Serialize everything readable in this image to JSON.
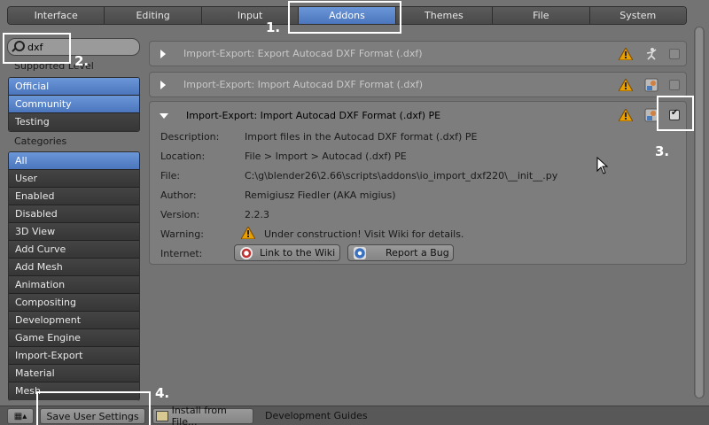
{
  "tabs": [
    {
      "label": "Interface"
    },
    {
      "label": "Editing"
    },
    {
      "label": "Input"
    },
    {
      "label": "Addons"
    },
    {
      "label": "Themes"
    },
    {
      "label": "File"
    },
    {
      "label": "System"
    }
  ],
  "search": {
    "value": "dxf"
  },
  "supported_level": {
    "label": "Supported Level",
    "items": [
      {
        "label": "Official"
      },
      {
        "label": "Community"
      },
      {
        "label": "Testing"
      }
    ]
  },
  "categories": {
    "label": "Categories",
    "items": [
      {
        "label": "All"
      },
      {
        "label": "User"
      },
      {
        "label": "Enabled"
      },
      {
        "label": "Disabled"
      },
      {
        "label": "3D View"
      },
      {
        "label": "Add Curve"
      },
      {
        "label": "Add Mesh"
      },
      {
        "label": "Animation"
      },
      {
        "label": "Compositing"
      },
      {
        "label": "Development"
      },
      {
        "label": "Game Engine"
      },
      {
        "label": "Import-Export"
      },
      {
        "label": "Material"
      },
      {
        "label": "Mesh"
      }
    ]
  },
  "addons": [
    {
      "name": "Import-Export: Export Autocad DXF Format (.dxf)",
      "enabled": false
    },
    {
      "name": "Import-Export: Import Autocad DXF Format (.dxf)",
      "enabled": false
    },
    {
      "name": "Import-Export: Import Autocad DXF Format (.dxf) PE",
      "enabled": true
    }
  ],
  "details": {
    "description_label": "Description:",
    "description": "Import files in the Autocad DXF format (.dxf) PE",
    "location_label": "Location:",
    "location": "File > Import > Autocad (.dxf) PE",
    "file_label": "File:",
    "file": "C:\\g\\blender26\\2.66\\scripts\\addons\\io_import_dxf220\\__init__.py",
    "author_label": "Author:",
    "author": "Remigiusz Fiedler (AKA migius)",
    "version_label": "Version:",
    "version": "2.2.3",
    "warning_label": "Warning:",
    "warning": "Under construction! Visit Wiki for details.",
    "internet_label": "Internet:",
    "wiki_button": "Link to the Wiki",
    "bug_button": "Report a Bug"
  },
  "annotations": [
    "1.",
    "2.",
    "3.",
    "4."
  ],
  "bottom": {
    "save_button": "Save User Settings",
    "install_button": "Install from File...",
    "dev_guides": "Development Guides"
  },
  "colors": {
    "selected": "#5680c2",
    "warning": "#e8a000"
  }
}
